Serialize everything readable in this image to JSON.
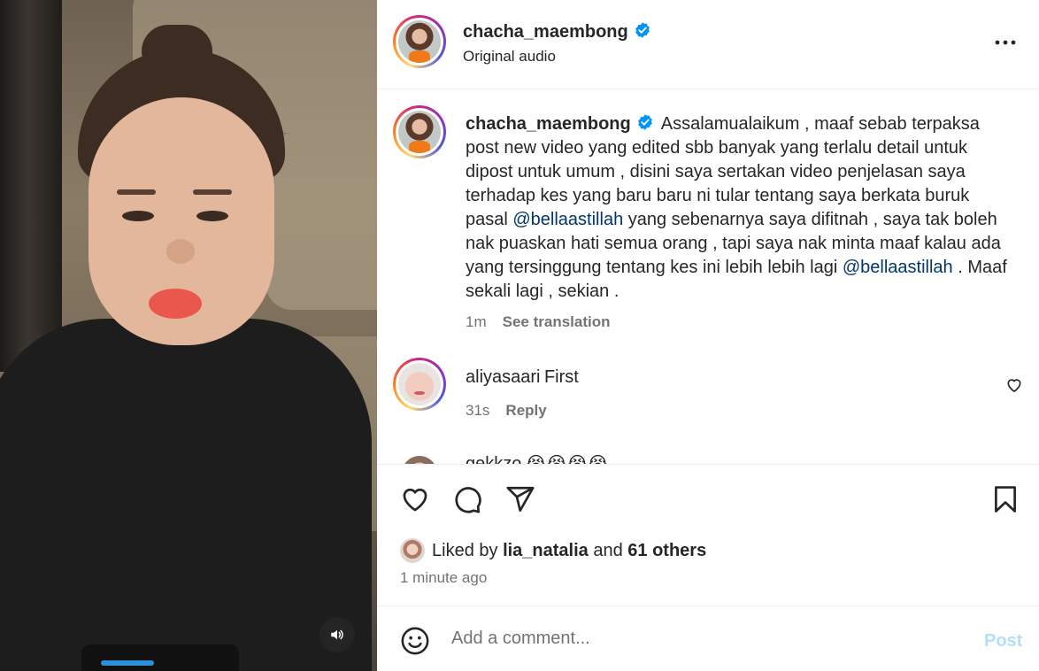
{
  "post": {
    "username": "chacha_maembong",
    "audio": "Original audio"
  },
  "caption": {
    "username": "chacha_maembong",
    "text_1": "Assalamualaikum , maaf sebab terpaksa post new video yang edited sbb banyak yang terlalu detail untuk dipost untuk umum , disini saya sertakan video penjelasan saya terhadap kes yang baru baru ni tular tentang saya berkata buruk pasal ",
    "mention_1": "@bellaastillah",
    "text_2": " yang sebenarnya saya difitnah , saya tak boleh nak puaskan hati semua orang , tapi saya nak minta maaf kalau ada yang tersinggung tentang kes ini lebih lebih lagi ",
    "mention_2": "@bellaastillah",
    "text_3": " . Maaf sekali lagi , sekian .",
    "age": "1m",
    "see_translation": "See translation"
  },
  "comments": [
    {
      "username": "aliyasaari",
      "text": "First",
      "age": "31s",
      "reply": "Reply"
    },
    {
      "username": "gekkzo",
      "text": "😭😭😭😭"
    }
  ],
  "likes": {
    "prefix": "Liked by",
    "user": "lia_natalia",
    "joiner": "and",
    "others": "61 others",
    "time": "1 minute ago"
  },
  "composer": {
    "placeholder": "Add a comment...",
    "post_label": "Post"
  },
  "colors": {
    "verified": "#0095f6",
    "link": "#00376b",
    "post_disabled": "#b2dffc"
  },
  "icons": [
    "volume-icon",
    "more-icon",
    "verified-icon",
    "heart-icon",
    "comment-icon",
    "share-icon",
    "bookmark-icon",
    "emoji-icon"
  ]
}
